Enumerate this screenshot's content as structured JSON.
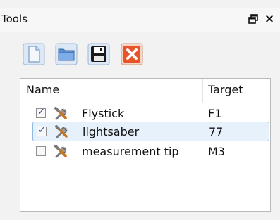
{
  "window": {
    "title": "Tools",
    "float_glyph": "🗗",
    "close_glyph": "×"
  },
  "toolbar": {
    "buttons": [
      {
        "icon": "new-document-icon"
      },
      {
        "icon": "open-folder-icon"
      },
      {
        "icon": "save-disk-icon"
      },
      {
        "icon": "delete-icon"
      }
    ]
  },
  "tree": {
    "columns": [
      "Name",
      "Target"
    ],
    "rows": [
      {
        "checked": true,
        "name": "Flystick",
        "target": "F1",
        "selected": false
      },
      {
        "checked": true,
        "name": "lightsaber",
        "target": "77",
        "selected": true
      },
      {
        "checked": false,
        "name": "measurement tip",
        "target": "M3",
        "selected": false
      }
    ],
    "check_glyph": "✓"
  },
  "colors": {
    "selection_fill": "#e7f1fb",
    "selection_border": "#8fb8e2",
    "delete_red": "#e8542a"
  }
}
